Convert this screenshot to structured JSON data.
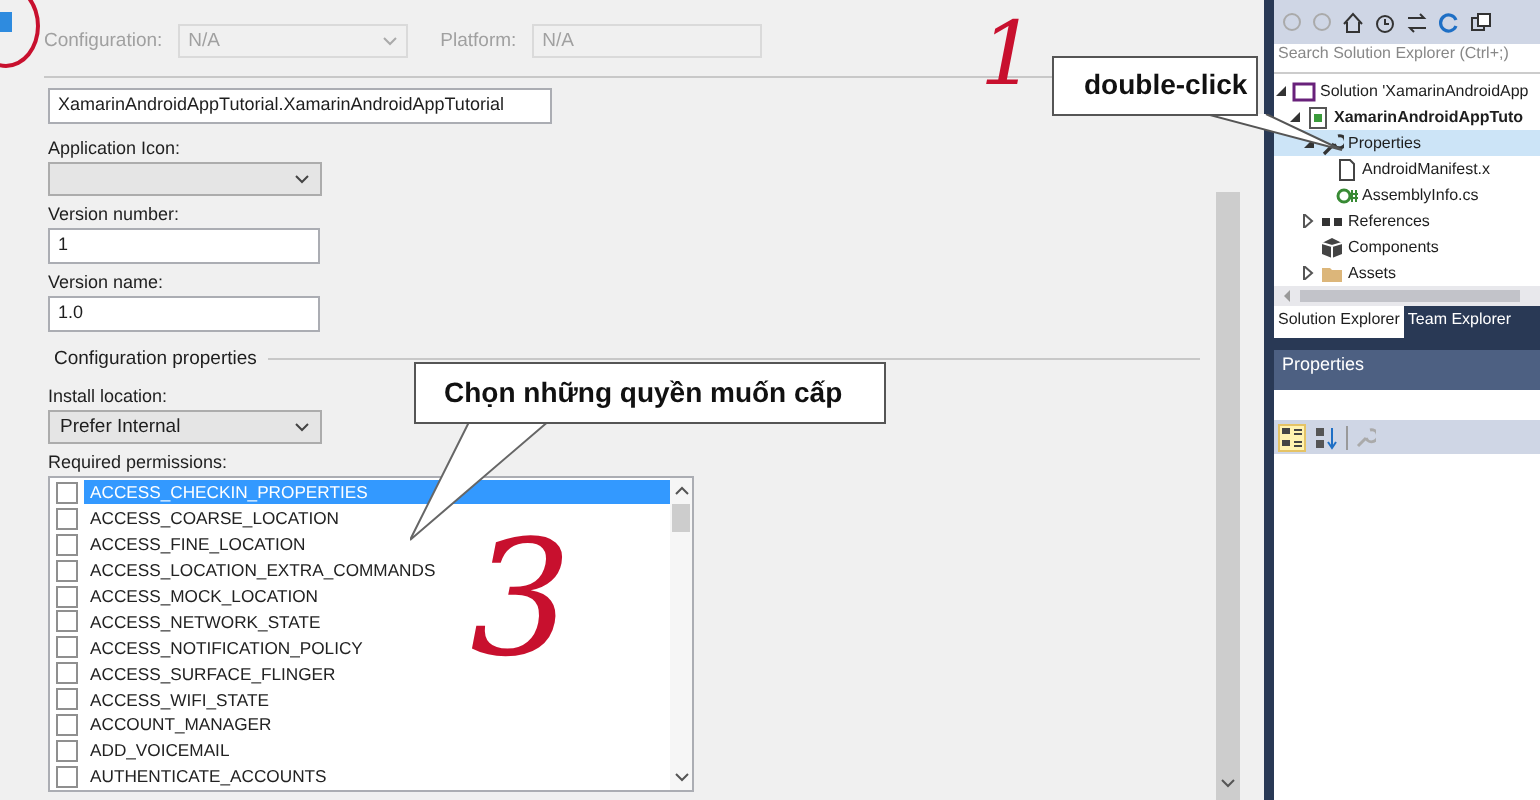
{
  "toolbar": {
    "configuration_label": "Configuration:",
    "configuration_value": "N/A",
    "platform_label": "Platform:",
    "platform_value": "N/A",
    "disabled": true
  },
  "form": {
    "package_name": "XamarinAndroidAppTutorial.XamarinAndroidAppTutorial",
    "app_icon_label": "Application Icon:",
    "version_number_label": "Version number:",
    "version_number": "1",
    "version_name_label": "Version name:",
    "version_name": "1.0",
    "section_title": "Configuration properties",
    "install_location_label": "Install location:",
    "install_location": "Prefer Internal",
    "permissions_label": "Required permissions:"
  },
  "permissions": [
    {
      "name": "ACCESS_CHECKIN_PROPERTIES",
      "checked": false,
      "selected": true
    },
    {
      "name": "ACCESS_COARSE_LOCATION",
      "checked": false,
      "selected": false
    },
    {
      "name": "ACCESS_FINE_LOCATION",
      "checked": false,
      "selected": false
    },
    {
      "name": "ACCESS_LOCATION_EXTRA_COMMANDS",
      "checked": false,
      "selected": false
    },
    {
      "name": "ACCESS_MOCK_LOCATION",
      "checked": false,
      "selected": false
    },
    {
      "name": "ACCESS_NETWORK_STATE",
      "checked": false,
      "selected": false
    },
    {
      "name": "ACCESS_NOTIFICATION_POLICY",
      "checked": false,
      "selected": false
    },
    {
      "name": "ACCESS_SURFACE_FLINGER",
      "checked": false,
      "selected": false
    },
    {
      "name": "ACCESS_WIFI_STATE",
      "checked": false,
      "selected": false
    },
    {
      "name": "ACCOUNT_MANAGER",
      "checked": false,
      "selected": false
    },
    {
      "name": "ADD_VOICEMAIL",
      "checked": false,
      "selected": false
    },
    {
      "name": "AUTHENTICATE_ACCOUNTS",
      "checked": false,
      "selected": false
    }
  ],
  "solution_explorer": {
    "search_placeholder": "Search Solution Explorer (Ctrl+;)",
    "tree": [
      {
        "label": "Solution 'XamarinAndroidApp",
        "kind": "solution",
        "expanded": true,
        "selected": false,
        "children": [
          {
            "label": "XamarinAndroidAppTuto",
            "kind": "project",
            "expanded": true,
            "selected": false,
            "children": [
              {
                "label": "Properties",
                "kind": "properties",
                "expanded": true,
                "selected": true,
                "children": [
                  {
                    "label": "AndroidManifest.x",
                    "kind": "file",
                    "selected": false
                  },
                  {
                    "label": "AssemblyInfo.cs",
                    "kind": "csharp",
                    "selected": false
                  }
                ]
              },
              {
                "label": "References",
                "kind": "references",
                "expanded": false,
                "selected": false
              },
              {
                "label": "Components",
                "kind": "components",
                "selected": false
              },
              {
                "label": "Assets",
                "kind": "folder",
                "expanded": false,
                "selected": false
              }
            ]
          }
        ]
      }
    ],
    "tabs": [
      {
        "label": "Solution Explorer",
        "selected": true
      },
      {
        "label": "Team Explorer",
        "selected": false
      }
    ]
  },
  "properties_panel": {
    "title": "Properties",
    "categorized_selected": true
  },
  "annotations": {
    "callout_top": "double-click",
    "callout_list": "Chọn những quyền muốn cấp",
    "mark_one": "1",
    "mark_three": "3"
  }
}
